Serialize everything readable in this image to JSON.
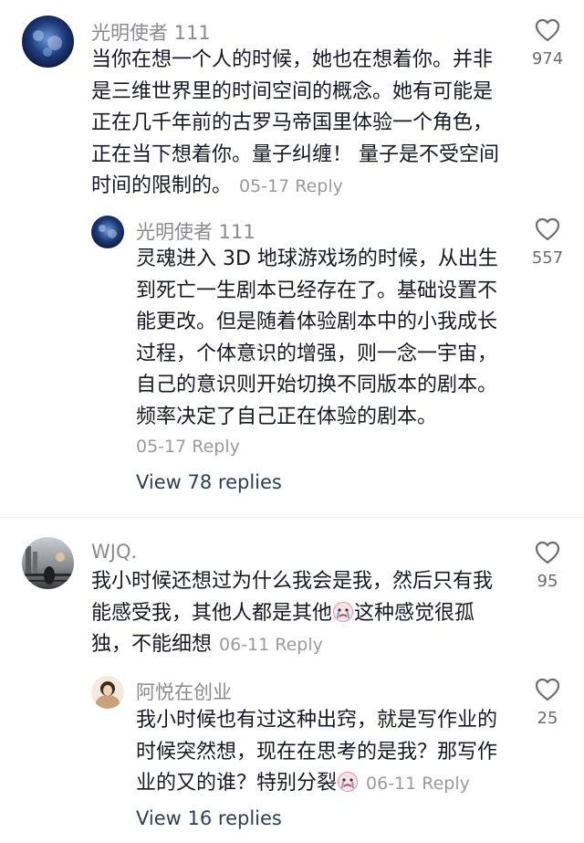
{
  "comments": [
    {
      "author": "光明使者 111",
      "lines": [
        "当你在想一个人的时候，她也在想着你。并非",
        "是三维世界里的时间空间的概念。她有可能是",
        "正在几千年前的古罗马帝国里体验一个角色，",
        "正在当下想着你。量子纠缠！ 量子是不受空间",
        "时间的限制的。"
      ],
      "date": "05-17",
      "reply_label": "Reply",
      "likes": "974",
      "replies": [
        {
          "author": "光明使者 111",
          "lines": [
            "灵魂进入 3D 地球游戏场的时候，从出生",
            "到死亡一生剧本已经存在了。基础设置不",
            "能更改。但是随着体验剧本中的小我成长",
            "过程，个体意识的增强，则一念一宇宙，",
            "自己的意识则开始切换不同版本的剧本。",
            "频率决定了自己正在体验的剧本。"
          ],
          "date": "05-17",
          "reply_label": "Reply",
          "likes": "557"
        }
      ],
      "view_replies": "View 78 replies"
    },
    {
      "author": "WJQ.",
      "lines": [
        "我小时候还想过为什么我会是我，然后只有我",
        "能感受我，其他人都是其他",
        "独，不能细想"
      ],
      "line2_tail": "这种感觉很孤",
      "date": "06-11",
      "reply_label": "Reply",
      "likes": "95",
      "replies": [
        {
          "author": "阿悦在创业",
          "lines": [
            "我小时候也有过这种出窍，就是写作业的",
            "时候突然想，现在在思考的是我？那写作",
            "业的又的谁？特别分裂"
          ],
          "date": "06-11",
          "reply_label": "Reply",
          "likes": "25"
        }
      ],
      "view_replies": "View 16 replies"
    }
  ],
  "icons": {
    "like": "heart-outline-icon",
    "emoji": "crying-face-emoji-icon"
  },
  "colors": {
    "author": "#8a8b91",
    "text": "#161823",
    "meta": "#9a9ba1",
    "link": "#2b3f5c"
  }
}
